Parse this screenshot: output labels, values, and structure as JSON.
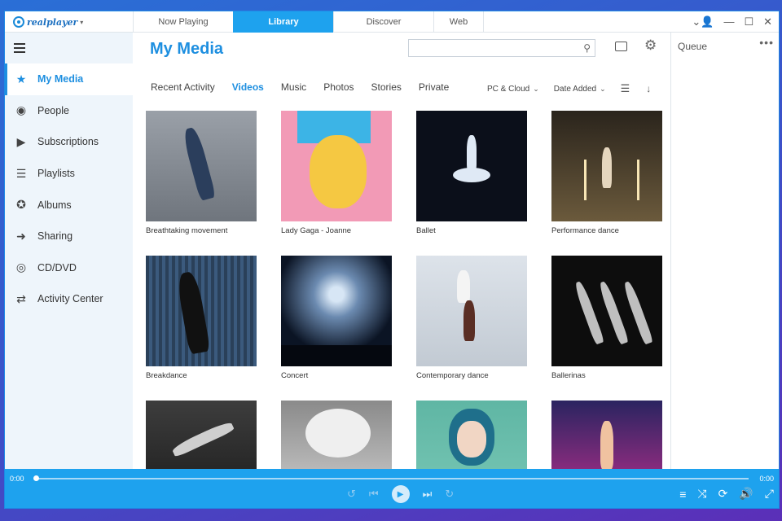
{
  "logo": {
    "text": "realplayer"
  },
  "tabs": [
    {
      "label": "Now Playing",
      "active": false
    },
    {
      "label": "Library",
      "active": true
    },
    {
      "label": "Discover",
      "active": false
    },
    {
      "label": "Web",
      "active": false
    }
  ],
  "sidebar": {
    "items": [
      {
        "label": "My Media",
        "icon": "star-icon",
        "active": true
      },
      {
        "label": "People",
        "icon": "person-icon",
        "active": false
      },
      {
        "label": "Subscriptions",
        "icon": "subscriptions-icon",
        "active": false
      },
      {
        "label": "Playlists",
        "icon": "playlist-icon",
        "active": false
      },
      {
        "label": "Albums",
        "icon": "album-icon",
        "active": false
      },
      {
        "label": "Sharing",
        "icon": "share-icon",
        "active": false
      },
      {
        "label": "CD/DVD",
        "icon": "disc-icon",
        "active": false
      },
      {
        "label": "Activity Center",
        "icon": "transfer-icon",
        "active": false
      }
    ]
  },
  "main": {
    "title": "My Media",
    "search": {
      "placeholder": "",
      "value": ""
    },
    "subtabs": [
      {
        "label": "Recent Activity",
        "active": false
      },
      {
        "label": "Videos",
        "active": true
      },
      {
        "label": "Music",
        "active": false
      },
      {
        "label": "Photos",
        "active": false
      },
      {
        "label": "Stories",
        "active": false
      },
      {
        "label": "Private",
        "active": false
      }
    ],
    "filters": {
      "source": "PC & Cloud",
      "sort": "Date Added"
    },
    "videos": [
      {
        "title": "Breathtaking movement"
      },
      {
        "title": "Lady Gaga  - Joanne"
      },
      {
        "title": "Ballet"
      },
      {
        "title": "Performance dance"
      },
      {
        "title": "Breakdance"
      },
      {
        "title": "Concert"
      },
      {
        "title": "Contemporary dance"
      },
      {
        "title": "Ballerinas"
      },
      {
        "title": ""
      },
      {
        "title": ""
      },
      {
        "title": ""
      },
      {
        "title": ""
      }
    ]
  },
  "queue": {
    "title": "Queue"
  },
  "player": {
    "current_time": "0:00",
    "total_time": "0:00",
    "progress": 0
  },
  "colors": {
    "accent": "#1ea2ee",
    "brand": "#1e8fe0"
  }
}
